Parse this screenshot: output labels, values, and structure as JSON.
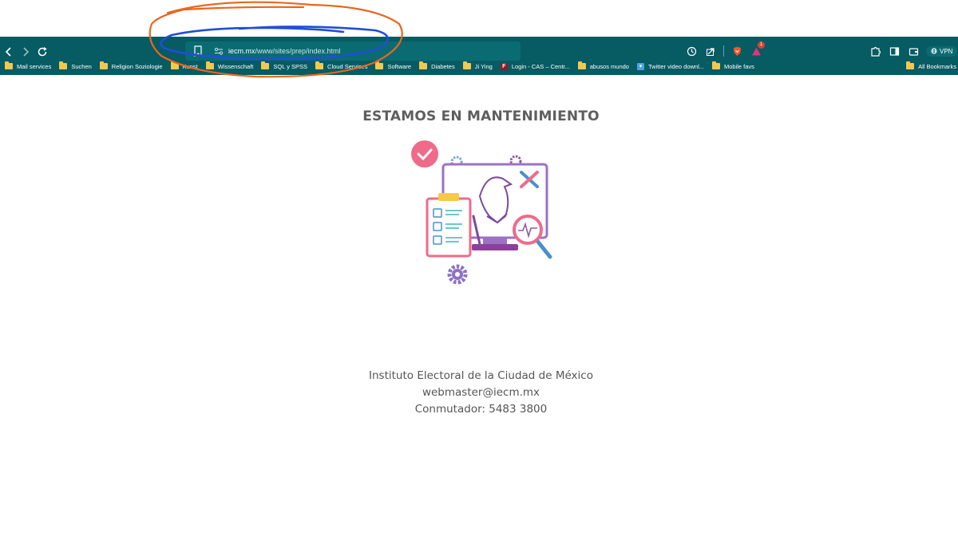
{
  "browser": {
    "url_host": "iecm.mx",
    "url_path": "/www/sites/prep/index.html",
    "vpn_label": "VPN",
    "brave_badge_count": "1",
    "bookmarks": [
      {
        "label": "Mail services",
        "type": "folder"
      },
      {
        "label": "Suchen",
        "type": "folder"
      },
      {
        "label": "Religion Soziologie",
        "type": "folder"
      },
      {
        "label": "Kunst",
        "type": "folder"
      },
      {
        "label": "Wissenschaft",
        "type": "folder"
      },
      {
        "label": "SQL y SPSS",
        "type": "folder"
      },
      {
        "label": "Cloud Services",
        "type": "folder"
      },
      {
        "label": "Software",
        "type": "folder"
      },
      {
        "label": "Diabetes",
        "type": "folder"
      },
      {
        "label": "Ji Ying",
        "type": "folder"
      },
      {
        "label": "Login - CAS – Centr...",
        "type": "site",
        "icon": "f-logo-icon"
      },
      {
        "label": "abusos mundo",
        "type": "folder"
      },
      {
        "label": "Twitter video downl...",
        "type": "site",
        "icon": "twitter-bird-icon"
      },
      {
        "label": "Mobile favs",
        "type": "folder"
      }
    ],
    "all_bookmarks_label": "All Bookmarks"
  },
  "page": {
    "title": "ESTAMOS EN MANTENIMIENTO",
    "institution": "Instituto Electoral de la Ciudad de México",
    "email": "webmaster@iecm.mx",
    "phone": "Conmutador: 5483 3800"
  },
  "colors": {
    "chrome_bg": "#075b63",
    "annotation_orange": "#e8661f",
    "annotation_blue": "#1f4fd6",
    "illustration_pink": "#ef6b8a",
    "illustration_purple": "#8e5aa8"
  }
}
